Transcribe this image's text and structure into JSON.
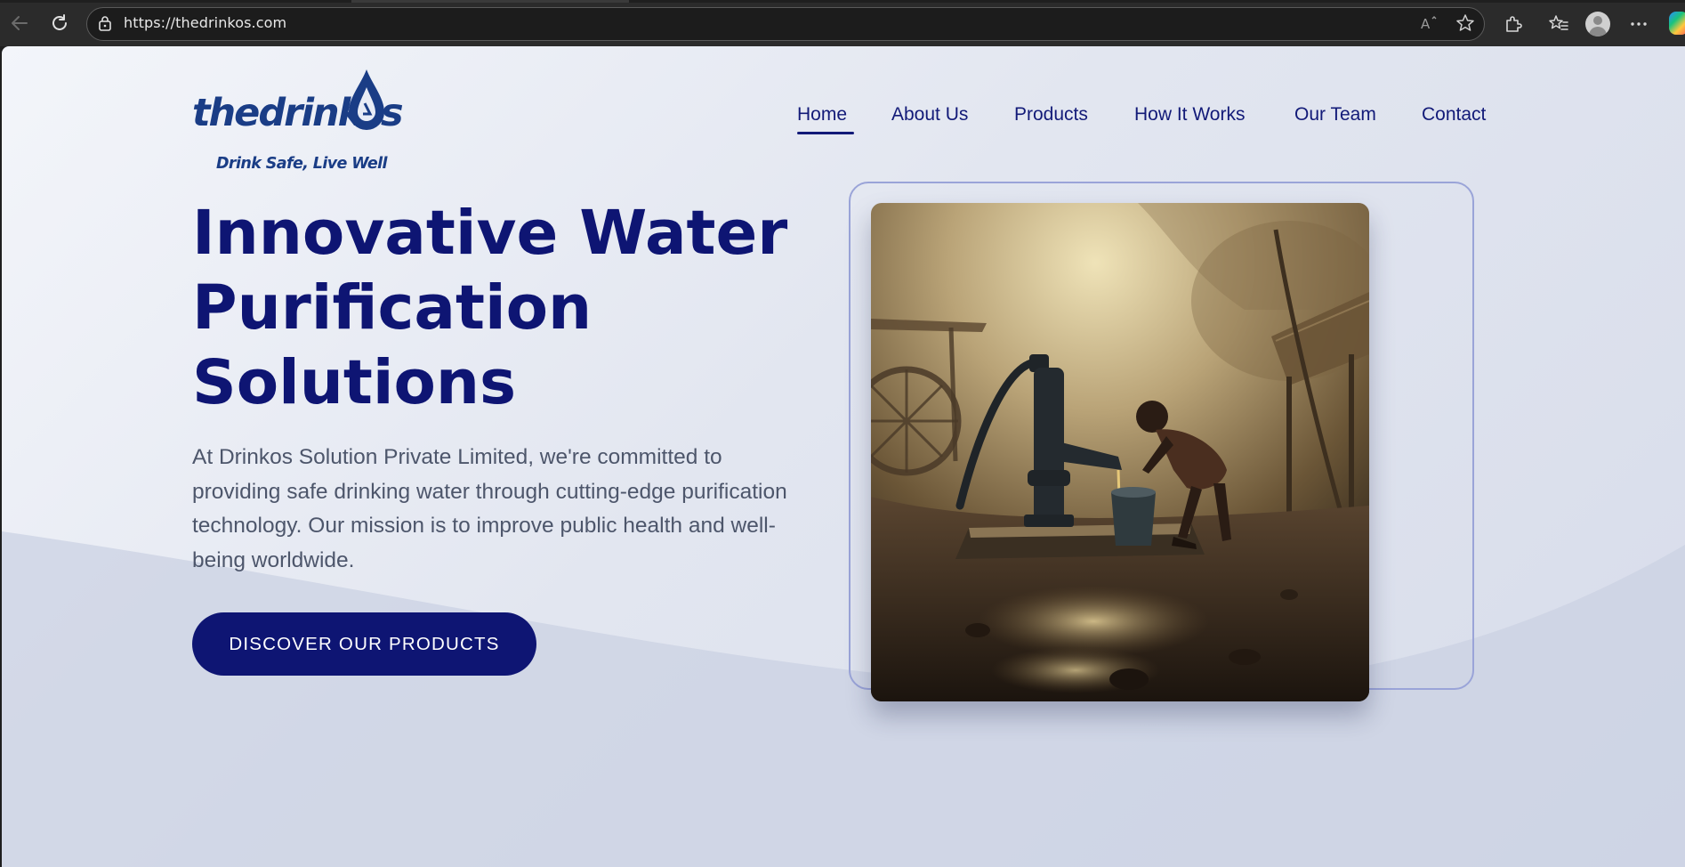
{
  "browser": {
    "url": "https://thedrinkos.com",
    "icons": {
      "back": "back-arrow-icon",
      "reload": "reload-icon",
      "site_info": "lock-icon",
      "read_aloud": "read-aloud-icon",
      "favorite": "star-icon",
      "extensions": "puzzle-icon",
      "favorites_bar": "favorites-icon",
      "profile": "avatar-icon",
      "more": "more-icon",
      "copilot": "copilot-icon"
    }
  },
  "site": {
    "logo": {
      "wordmark": "thedrinkos",
      "tagline": "Drink Safe, Live Well",
      "brand_color": "#1a3d86"
    },
    "nav": {
      "items": [
        {
          "label": "Home",
          "active": true
        },
        {
          "label": "About Us",
          "active": false
        },
        {
          "label": "Products",
          "active": false
        },
        {
          "label": "How It Works",
          "active": false
        },
        {
          "label": "Our Team",
          "active": false
        },
        {
          "label": "Contact",
          "active": false
        }
      ],
      "color": "#121a78"
    },
    "hero": {
      "title_lines": [
        "Innovative Water",
        "Purification",
        "Solutions"
      ],
      "description": "At Drinkos Solution Private Limited, we're committed to providing safe drinking water through cutting-edge purification technology. Our mission is to improve public health and well-being worldwide.",
      "cta_label": "DISCOVER OUR PRODUCTS",
      "accent_color": "#0e1573",
      "image_subject": "child-at-hand-water-pump-photo"
    }
  }
}
